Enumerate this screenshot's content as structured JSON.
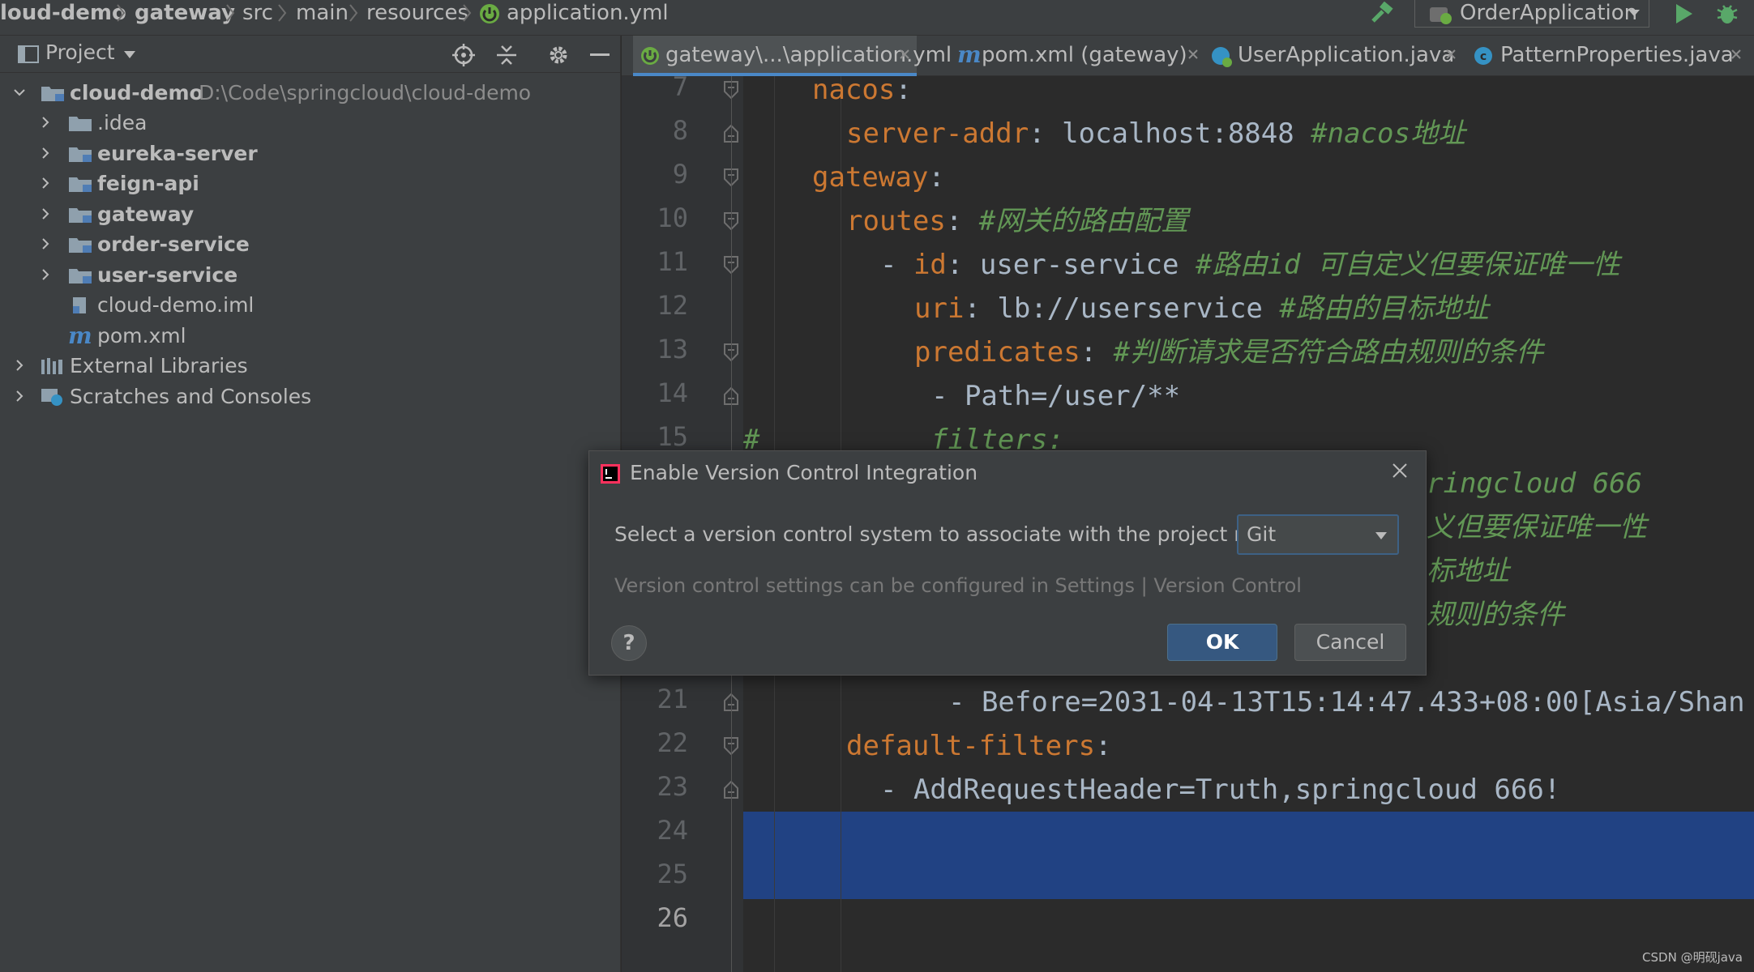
{
  "breadcrumb": [
    {
      "label": "loud-demo",
      "bold": true
    },
    {
      "label": "gateway",
      "bold": true
    },
    {
      "label": "src",
      "bold": false
    },
    {
      "label": "main",
      "bold": false
    },
    {
      "label": "resources",
      "bold": false
    },
    {
      "label": "application.yml",
      "bold": false
    }
  ],
  "toolbar": {
    "run_config": "OrderApplication"
  },
  "project_panel": {
    "title": "Project",
    "root": {
      "label": "cloud-demo",
      "path": "D:\\Code\\springcloud\\cloud-demo"
    },
    "items": [
      {
        "label": ".idea",
        "bold": false
      },
      {
        "label": "eureka-server",
        "bold": true
      },
      {
        "label": "feign-api",
        "bold": true
      },
      {
        "label": "gateway",
        "bold": true
      },
      {
        "label": "order-service",
        "bold": true
      },
      {
        "label": "user-service",
        "bold": true
      },
      {
        "label": "cloud-demo.iml",
        "bold": false
      },
      {
        "label": "pom.xml",
        "bold": false
      }
    ],
    "external_libraries": "External Libraries",
    "scratches": "Scratches and Consoles"
  },
  "editor_tabs": [
    {
      "label": "gateway\\...\\application.yml",
      "active": true
    },
    {
      "label": "pom.xml (gateway)",
      "active": false
    },
    {
      "label": "UserApplication.java",
      "active": false
    },
    {
      "label": "PatternProperties.java",
      "active": false
    }
  ],
  "code": {
    "line_numbers": [
      "7",
      "8",
      "9",
      "10",
      "11",
      "12",
      "13",
      "14",
      "15",
      "21",
      "22",
      "23",
      "24",
      "25",
      "26"
    ],
    "lines": [
      {
        "key": "nacos",
        "sep": ":",
        "value": "",
        "comment": ""
      },
      {
        "key": "server-addr",
        "sep": ": ",
        "value": "localhost:8848 ",
        "comment": "#nacos地址"
      },
      {
        "key": "gateway",
        "sep": ":",
        "value": "",
        "comment": ""
      },
      {
        "key": "routes",
        "sep": ": ",
        "value": "",
        "comment": "#网关的路由配置"
      },
      {
        "prefix": "- ",
        "key": "id",
        "sep": ": ",
        "value": "user-service ",
        "comment": "#路由id 可自定义但要保证唯一性"
      },
      {
        "key": "uri",
        "sep": ": ",
        "value": "lb://userservice ",
        "comment": "#路由的目标地址"
      },
      {
        "key": "predicates",
        "sep": ": ",
        "value": "",
        "comment": "#判断请求是否符合路由规则的条件"
      },
      {
        "value": "- Path=/user/**"
      },
      {
        "comment_line": "#",
        "comment": "filters:"
      },
      {
        "value": "- Before=2031-04-13T15:14:47.433+08:00[Asia/Shan"
      },
      {
        "key": "default-filters",
        "sep": ":",
        "value": "",
        "comment": ""
      },
      {
        "value": "- AddRequestHeader=Truth,springcloud 666!"
      }
    ],
    "peek": {
      "l16": "ringcloud 666",
      "l17": "义但要保证唯一性",
      "l18": "标地址",
      "l19": "规则的条件"
    }
  },
  "dialog": {
    "title": "Enable Version Control Integration",
    "prompt": "Select a version control system to associate with the project root:",
    "vcs_selected": "Git",
    "hint": "Version control settings can be configured in Settings | Version Control",
    "help_label": "?",
    "ok_label": "OK",
    "cancel_label": "Cancel"
  },
  "watermark": "CSDN @明砚java",
  "colors": {
    "accent": "#4a88c7",
    "selection": "#214283",
    "key": "#cc7832",
    "comment": "#629755",
    "ok_button": "#365880"
  }
}
